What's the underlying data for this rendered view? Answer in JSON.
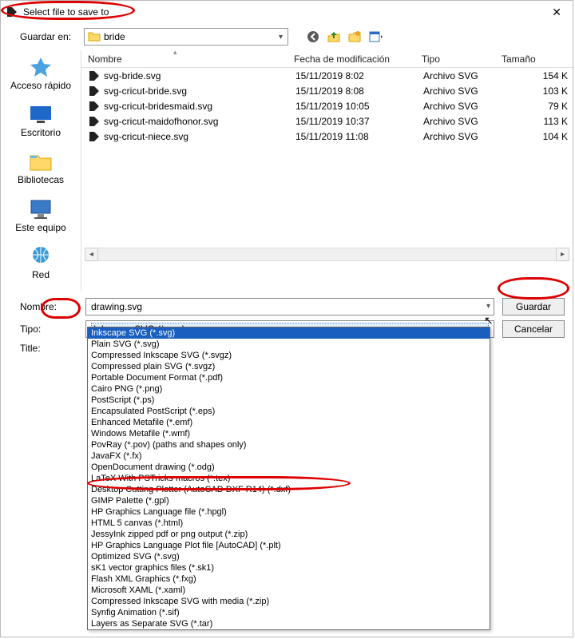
{
  "title": "Select file to save to",
  "guardar_en_label": "Guardar en:",
  "current_folder": "bride",
  "columns": {
    "name": "Nombre",
    "date": "Fecha de modificación",
    "type": "Tipo",
    "size": "Tamaño"
  },
  "files": [
    {
      "name": "svg-bride.svg",
      "date": "15/11/2019 8:02",
      "type": "Archivo SVG",
      "size": "154 K"
    },
    {
      "name": "svg-cricut-bride.svg",
      "date": "15/11/2019 8:08",
      "type": "Archivo SVG",
      "size": "103 K"
    },
    {
      "name": "svg-cricut-bridesmaid.svg",
      "date": "15/11/2019 10:05",
      "type": "Archivo SVG",
      "size": "79 K"
    },
    {
      "name": "svg-cricut-maidofhonor.svg",
      "date": "15/11/2019 10:37",
      "type": "Archivo SVG",
      "size": "113 K"
    },
    {
      "name": "svg-cricut-niece.svg",
      "date": "15/11/2019 11:08",
      "type": "Archivo SVG",
      "size": "104 K"
    }
  ],
  "places": [
    {
      "label": "Acceso rápido"
    },
    {
      "label": "Escritorio"
    },
    {
      "label": "Bibliotecas"
    },
    {
      "label": "Este equipo"
    },
    {
      "label": "Red"
    }
  ],
  "labels": {
    "nombre": "Nombre:",
    "tipo": "Tipo:",
    "title": "Title:"
  },
  "filename_value": "drawing.svg",
  "type_selected": "Inkscape SVG (*.svg)",
  "buttons": {
    "save": "Guardar",
    "cancel": "Cancelar"
  },
  "type_options": [
    "Inkscape SVG (*.svg)",
    "Plain SVG (*.svg)",
    "Compressed Inkscape SVG (*.svgz)",
    "Compressed plain SVG (*.svgz)",
    "Portable Document Format (*.pdf)",
    "Cairo PNG (*.png)",
    "PostScript (*.ps)",
    "Encapsulated PostScript (*.eps)",
    "Enhanced Metafile (*.emf)",
    "Windows Metafile (*.wmf)",
    "PovRay (*.pov) (paths and shapes only)",
    "JavaFX (*.fx)",
    "OpenDocument drawing (*.odg)",
    "LaTeX With PSTricks macros (*.tex)",
    "Desktop Cutting Plotter (AutoCAD DXF R14) (*.dxf)",
    "GIMP Palette (*.gpl)",
    "HP Graphics Language file (*.hpgl)",
    "HTML 5 canvas (*.html)",
    "JessyInk zipped pdf or png output (*.zip)",
    "HP Graphics Language Plot file [AutoCAD] (*.plt)",
    "Optimized SVG (*.svg)",
    "sK1 vector graphics files (*.sk1)",
    "Flash XML Graphics (*.fxg)",
    "Microsoft XAML (*.xaml)",
    "Compressed Inkscape SVG with media (*.zip)",
    "Synfig Animation (*.sif)",
    "Layers as Separate SVG (*.tar)"
  ]
}
